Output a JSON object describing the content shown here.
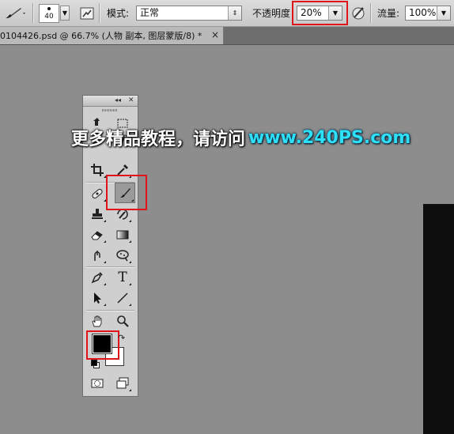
{
  "options_bar": {
    "brush_size": "40",
    "mode_label": "模式:",
    "mode_value": "正常",
    "opacity_label": "不透明度",
    "opacity_value": "20%",
    "flow_label": "流量:",
    "flow_value": "100%"
  },
  "document": {
    "tab_title": "0104426.psd @ 66.7% (人物 副本, 图层蒙版/8) *",
    "close_glyph": "×"
  },
  "watermark": {
    "text_cn": "更多精品教程，请访问",
    "text_url": "www.240PS.com"
  },
  "tools": {
    "type_glyph": "T",
    "collapse_glyph": "◂◂",
    "close_glyph": "✕",
    "foreground_color": "#000000",
    "background_color": "#ffffff"
  },
  "colors": {
    "highlight_red": "#e0151b",
    "watermark_cyan": "#2ee0f7"
  }
}
